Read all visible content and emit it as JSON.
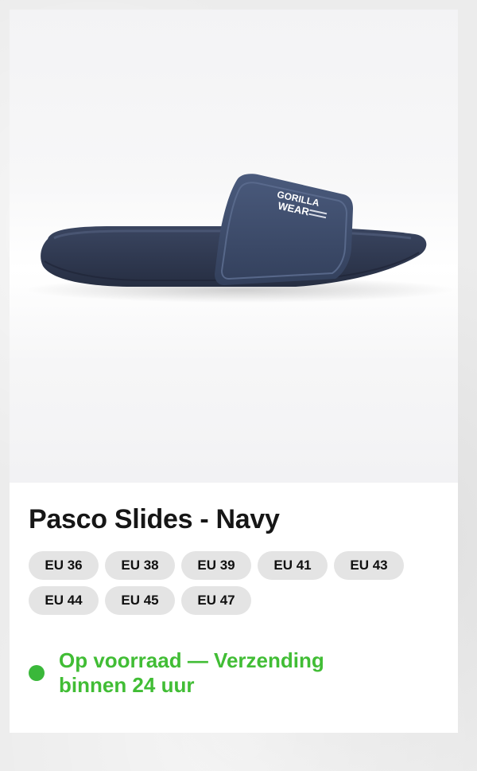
{
  "product": {
    "image_alt": "Pasco Slides - Navy",
    "logo_lines": [
      "GORILLA",
      "WEAR"
    ],
    "title": "Pasco Slides - Navy"
  },
  "sizes": [
    "EU 36",
    "EU 38",
    "EU 39",
    "EU 41",
    "EU 43",
    "EU 44",
    "EU 45",
    "EU 47"
  ],
  "stock": {
    "text": "Op voorraad — Verzending binnen 24 uur",
    "icon": "status-dot-icon",
    "color": "#41bd35"
  },
  "colors": {
    "slide_navy": "#3d4a66",
    "sole_navy": "#333c52",
    "chip_bg": "#e4e4e4"
  }
}
